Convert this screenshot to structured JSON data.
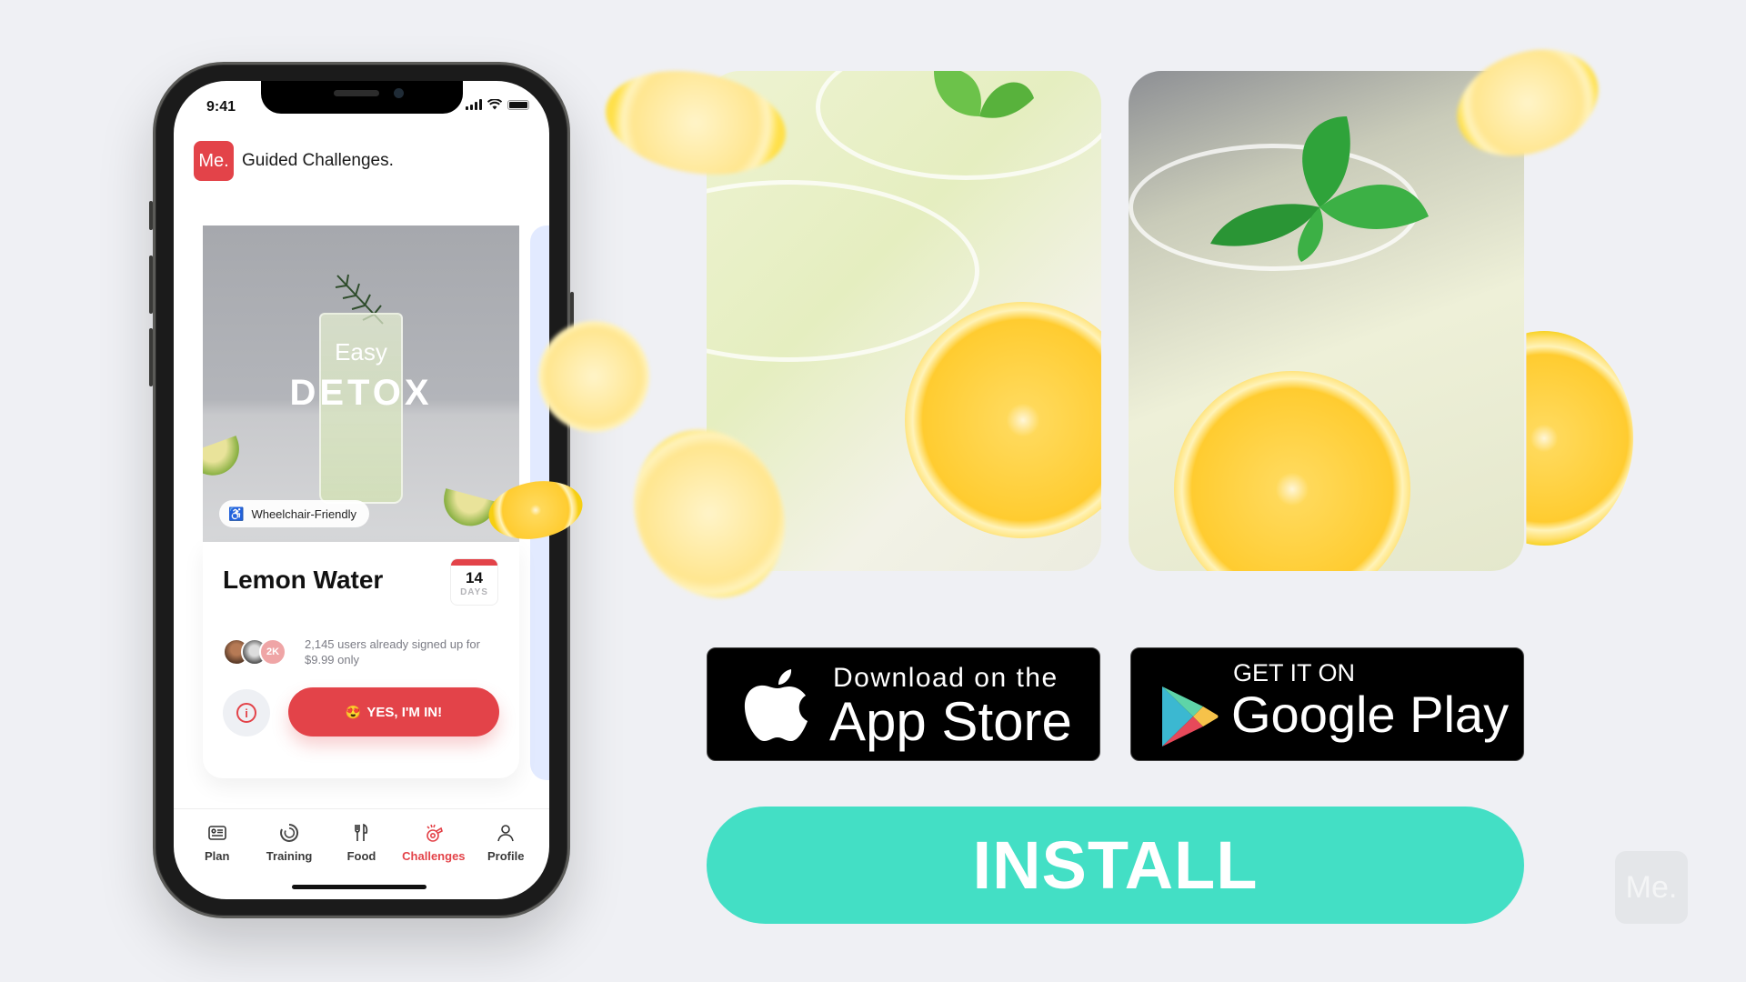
{
  "phone": {
    "status_bar": {
      "time": "9:41",
      "icons": [
        "signal-icon",
        "wifi-icon",
        "battery-icon"
      ]
    },
    "app": {
      "logo_text": "Me.",
      "title": "Guided Challenges."
    },
    "hero": {
      "subtitle": "Easy",
      "title": "DETOX",
      "badge": {
        "icon": "wheelchair-icon",
        "label": "Wheelchair-Friendly"
      }
    },
    "challenge": {
      "name": "Lemon Water",
      "duration_value": "14",
      "duration_unit": "DAYS",
      "avatar_count_badge": "2K",
      "signup_text": "2,145 users already signed up for $9.99 only",
      "info_icon": "info-icon",
      "cta_emoji": "😍",
      "cta_label": "YES, I'M IN!"
    },
    "tabs": [
      {
        "label": "Plan",
        "icon": "plan-icon",
        "active": false
      },
      {
        "label": "Training",
        "icon": "training-icon",
        "active": false
      },
      {
        "label": "Food",
        "icon": "food-icon",
        "active": false
      },
      {
        "label": "Challenges",
        "icon": "challenges-icon",
        "active": true
      },
      {
        "label": "Profile",
        "icon": "profile-icon",
        "active": false
      }
    ]
  },
  "store_buttons": {
    "app_store": {
      "small": "Download on the",
      "big": "App Store",
      "icon": "apple-icon"
    },
    "google_play": {
      "small": "GET IT ON",
      "big": "Google Play",
      "icon": "google-play-icon"
    }
  },
  "install_label": "INSTALL",
  "watermark": "Me.",
  "colors": {
    "brand_red": "#e34349",
    "install_teal": "#43dfc5",
    "background": "#eff0f4"
  }
}
